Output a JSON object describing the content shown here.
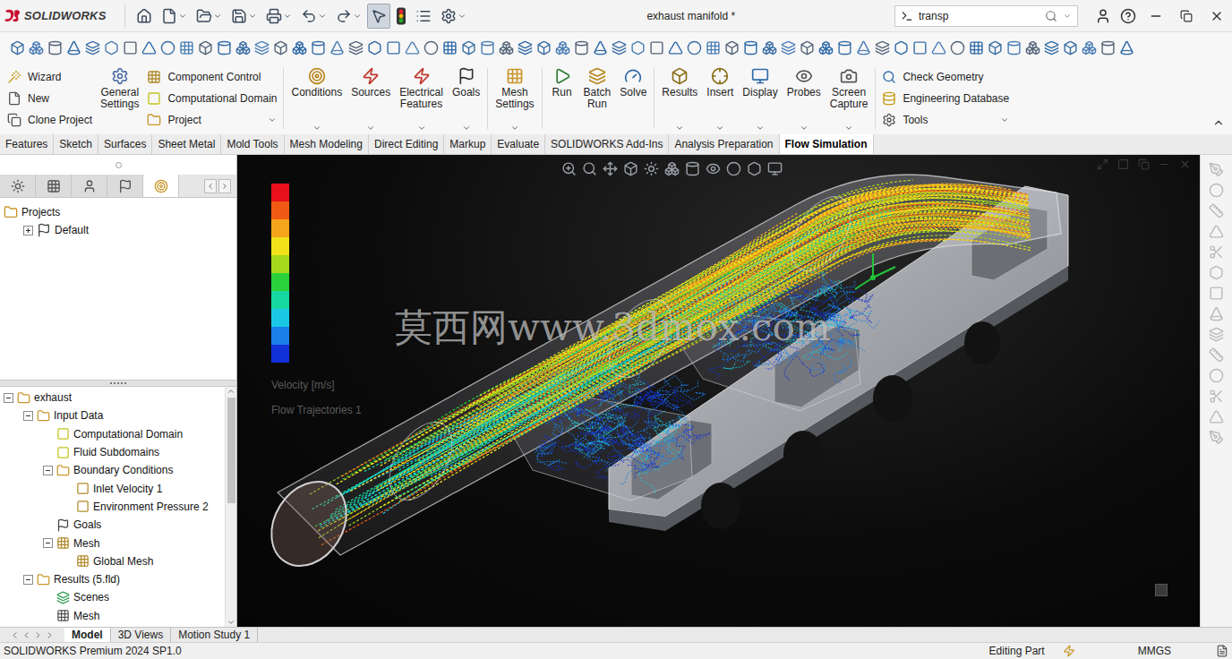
{
  "window": {
    "title": "exhaust manifold *"
  },
  "logo": {
    "brand": "SOLIDWORKS"
  },
  "quick_access": {
    "select_tool_active": true
  },
  "search": {
    "value": "transp"
  },
  "command_manager": {
    "groups": [
      {
        "kind": "column",
        "separator": false,
        "items": [
          {
            "label": "Wizard",
            "dropdown": false
          },
          {
            "label": "New",
            "dropdown": false
          },
          {
            "label": "Clone Project",
            "dropdown": false
          }
        ]
      },
      {
        "kind": "big",
        "separator": false,
        "items": [
          {
            "label": "General Settings",
            "dropdown": false
          }
        ]
      },
      {
        "kind": "column",
        "separator": false,
        "items": [
          {
            "label": "Component Control",
            "dropdown": false
          },
          {
            "label": "Computational Domain",
            "dropdown": false
          },
          {
            "label": "Project",
            "dropdown": true
          }
        ]
      },
      {
        "kind": "big",
        "separator": true,
        "items": [
          {
            "label": "Conditions",
            "dropdown": true
          },
          {
            "label": "Sources",
            "dropdown": true
          },
          {
            "label": "Electrical Features",
            "dropdown": true
          },
          {
            "label": "Goals",
            "dropdown": true
          }
        ]
      },
      {
        "kind": "big",
        "separator": true,
        "items": [
          {
            "label": "Mesh Settings",
            "dropdown": true
          }
        ]
      },
      {
        "kind": "big",
        "separator": true,
        "items": [
          {
            "label": "Run",
            "dropdown": false
          },
          {
            "label": "Batch Run",
            "dropdown": false
          },
          {
            "label": "Solve",
            "dropdown": false
          }
        ]
      },
      {
        "kind": "big",
        "separator": true,
        "items": [
          {
            "label": "Results",
            "dropdown": true
          },
          {
            "label": "Insert",
            "dropdown": true
          },
          {
            "label": "Display",
            "dropdown": true
          },
          {
            "label": "Probes",
            "dropdown": true
          },
          {
            "label": "Screen Capture",
            "dropdown": true
          }
        ]
      },
      {
        "kind": "column",
        "separator": true,
        "items": [
          {
            "label": "Check Geometry",
            "dropdown": false
          },
          {
            "label": "Engineering Database",
            "dropdown": false
          },
          {
            "label": "Tools",
            "dropdown": true
          }
        ]
      }
    ]
  },
  "tabs": [
    {
      "label": "Features",
      "selected": false
    },
    {
      "label": "Sketch",
      "selected": false
    },
    {
      "label": "Surfaces",
      "selected": false
    },
    {
      "label": "Sheet Metal",
      "selected": false
    },
    {
      "label": "Mold Tools",
      "selected": false
    },
    {
      "label": "Mesh Modeling",
      "selected": false
    },
    {
      "label": "Direct Editing",
      "selected": false
    },
    {
      "label": "Markup",
      "selected": false
    },
    {
      "label": "Evaluate",
      "selected": false
    },
    {
      "label": "SOLIDWORKS Add-Ins",
      "selected": false
    },
    {
      "label": "Analysis Preparation",
      "selected": false
    },
    {
      "label": "Flow Simulation",
      "selected": true
    }
  ],
  "feature_manager": {
    "panel_tabs": [
      {
        "selected": false
      },
      {
        "selected": false
      },
      {
        "selected": false
      },
      {
        "selected": false
      },
      {
        "selected": true
      }
    ],
    "projects": [
      {
        "label": "Projects",
        "level": 0,
        "expandable": false,
        "expanded": false
      },
      {
        "label": "Default",
        "level": 1,
        "expandable": true,
        "expanded": false
      }
    ],
    "tree": [
      {
        "label": "exhaust",
        "level": 0,
        "expandable": true,
        "expanded": true
      },
      {
        "label": "Input Data",
        "level": 1,
        "expandable": true,
        "expanded": true
      },
      {
        "label": "Computational Domain",
        "level": 2,
        "expandable": false,
        "expanded": false
      },
      {
        "label": "Fluid Subdomains",
        "level": 2,
        "expandable": false,
        "expanded": false
      },
      {
        "label": "Boundary Conditions",
        "level": 2,
        "expandable": true,
        "expanded": true
      },
      {
        "label": "Inlet Velocity 1",
        "level": 3,
        "expandable": false,
        "expanded": false
      },
      {
        "label": "Environment Pressure 2",
        "level": 3,
        "expandable": false,
        "expanded": false
      },
      {
        "label": "Goals",
        "level": 2,
        "expandable": false,
        "expanded": false
      },
      {
        "label": "Mesh",
        "level": 2,
        "expandable": true,
        "expanded": true
      },
      {
        "label": "Global Mesh",
        "level": 3,
        "expandable": false,
        "expanded": false
      },
      {
        "label": "Results (5.fld)",
        "level": 1,
        "expandable": true,
        "expanded": true
      },
      {
        "label": "Scenes",
        "level": 2,
        "expandable": false,
        "expanded": false
      },
      {
        "label": "Mesh",
        "level": 2,
        "expandable": false,
        "expanded": false
      }
    ]
  },
  "viewport": {
    "legend": {
      "title": "Velocity [m/s]",
      "subtitle": "Flow Trajectories 1",
      "colors": [
        "#e8101a",
        "#f05a14",
        "#f5a51c",
        "#f2e21a",
        "#a6d81e",
        "#2bd13a",
        "#17d8a0",
        "#1ac8e6",
        "#1a7fe8",
        "#1230d8"
      ]
    },
    "watermark": "莫西网www.3dmox.com"
  },
  "bottom_tabs": [
    {
      "label": "Model",
      "selected": true
    },
    {
      "label": "3D Views",
      "selected": false
    },
    {
      "label": "Motion Study 1",
      "selected": false
    }
  ],
  "status_bar": {
    "product": "SOLIDWORKS Premium 2024 SP1.0",
    "mode": "Editing Part",
    "units": "MMGS"
  }
}
